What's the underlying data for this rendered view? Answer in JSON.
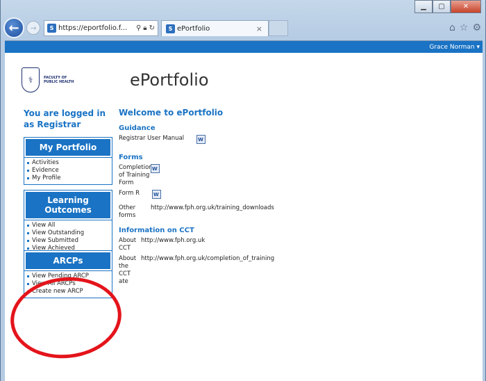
{
  "browser": {
    "address": "https://eportfolio.f...",
    "tab_title": "ePortfolio",
    "tab_close": "×"
  },
  "user": {
    "name": "Grace Norman ▾"
  },
  "logo": {
    "line1": "FACULTY OF",
    "line2": "PUBLIC HEALTH"
  },
  "site_title": "ePortfolio",
  "sidebar": {
    "logged_in": "You are logged in as Registrar",
    "panels": [
      {
        "title": "My Portfolio",
        "items": [
          "Activities",
          "Evidence",
          "My Profile"
        ]
      },
      {
        "title": "Learning Outcomes",
        "items": [
          "View All",
          "View Outstanding",
          "View Submitted",
          "View Achieved"
        ]
      },
      {
        "title": "ARCPs",
        "items": [
          "View Pending ARCP",
          "View All ARCPs",
          "Create new ARCP"
        ]
      }
    ]
  },
  "main": {
    "welcome": "Welcome to ePortfolio",
    "guidance": {
      "heading": "Guidance",
      "item": "Registrar User Manual"
    },
    "forms": {
      "heading": "Forms",
      "completion": "Completion of Training Form",
      "form_r": "Form R",
      "other": "Other forms",
      "other_link": "http://www.fph.org.uk/training_downloads"
    },
    "cct": {
      "heading": "Information on CCT",
      "about_cct": "About CCT",
      "about_cct_link": "http://www.fph.org.uk",
      "about_cert": "About the CCT ate",
      "about_cert_link": "http://www.fph.org.uk/completion_of_training"
    }
  },
  "colors": {
    "accent": "#1a73c4",
    "annotation": "#e4141b"
  },
  "icons": [
    "back-arrow-icon",
    "forward-arrow-icon",
    "search-icon",
    "lock-icon",
    "refresh-icon",
    "home-icon",
    "star-icon",
    "gear-icon",
    "word-document-icon"
  ]
}
